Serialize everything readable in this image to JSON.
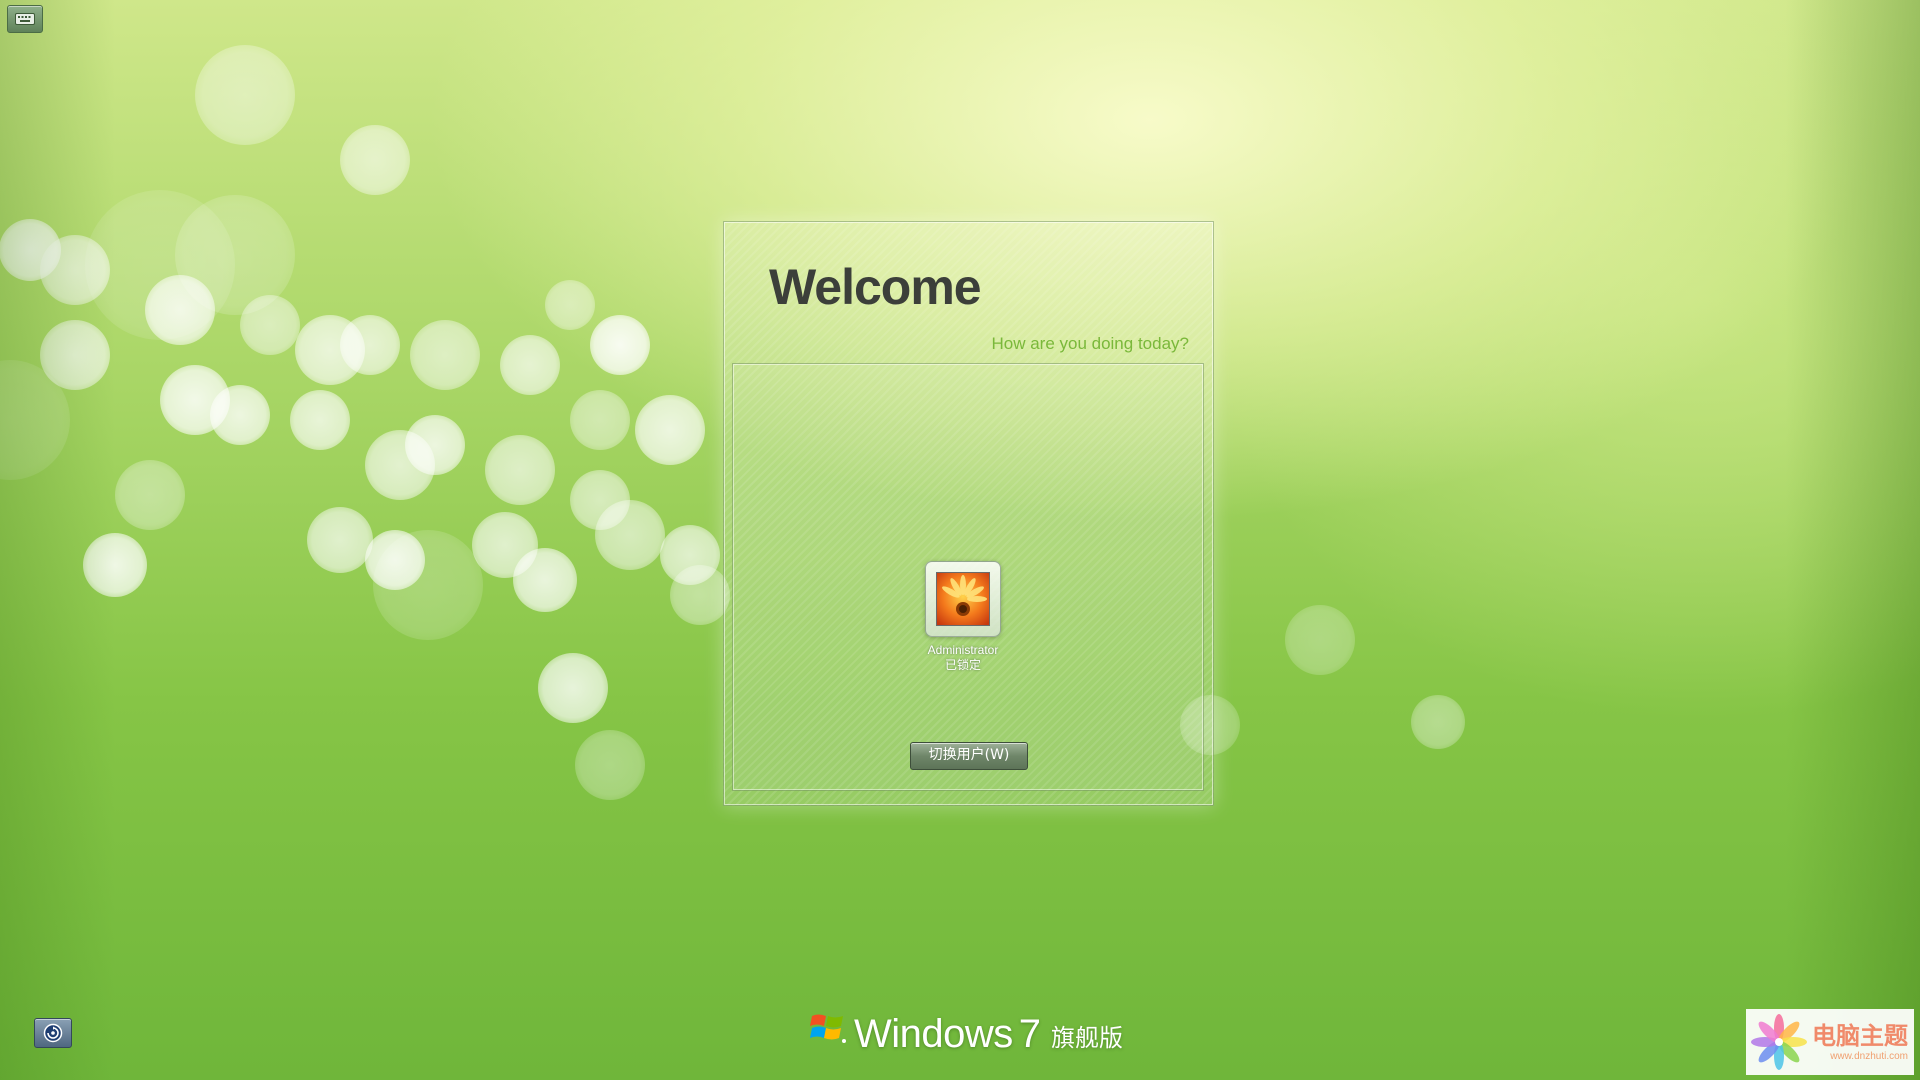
{
  "welcome": {
    "title": "Welcome",
    "subtitle": "How are you doing today?"
  },
  "user": {
    "name": "Administrator",
    "status": "已锁定"
  },
  "buttons": {
    "switch_user": "切换用户(W)"
  },
  "brand": {
    "windows": "Windows",
    "version": "7",
    "edition": "旗舰版"
  },
  "watermark": {
    "site_name": "电脑主题",
    "url": "www.dnzhuti.com"
  },
  "icons": {
    "top_left": "keyboard-icon",
    "bottom_left": "ease-of-access-icon",
    "brand_logo": "windows-flag-icon",
    "user_picture": "flower-icon",
    "watermark_logo": "pinwheel-icon"
  },
  "colors": {
    "subtitle": "#7ab83a",
    "title": "#3c3f3a",
    "background_light": "#f3f8c0",
    "background_dark": "#6fb63a"
  }
}
